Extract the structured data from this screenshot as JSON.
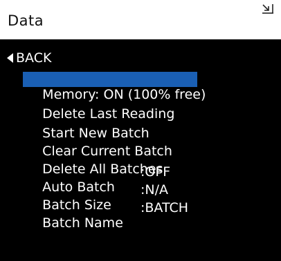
{
  "header": {
    "title": "Data",
    "icon": "collapse-icon"
  },
  "menu": {
    "back_label": "BACK",
    "items": [
      {
        "label": "Memory: ON (100% free)",
        "selected": true
      },
      {
        "label": "Delete Last Reading"
      },
      {
        "label": "Start New Batch"
      },
      {
        "label": "Clear Current Batch"
      },
      {
        "label": "Delete All Batches"
      },
      {
        "label": "Auto Batch",
        "value": ":OFF"
      },
      {
        "label": "Batch Size",
        "value": ":N/A"
      },
      {
        "label": "Batch Name",
        "value": ":BATCH"
      }
    ]
  },
  "colors": {
    "highlight": "#1a5fb4",
    "background": "#000000",
    "header": "#ffffff"
  }
}
